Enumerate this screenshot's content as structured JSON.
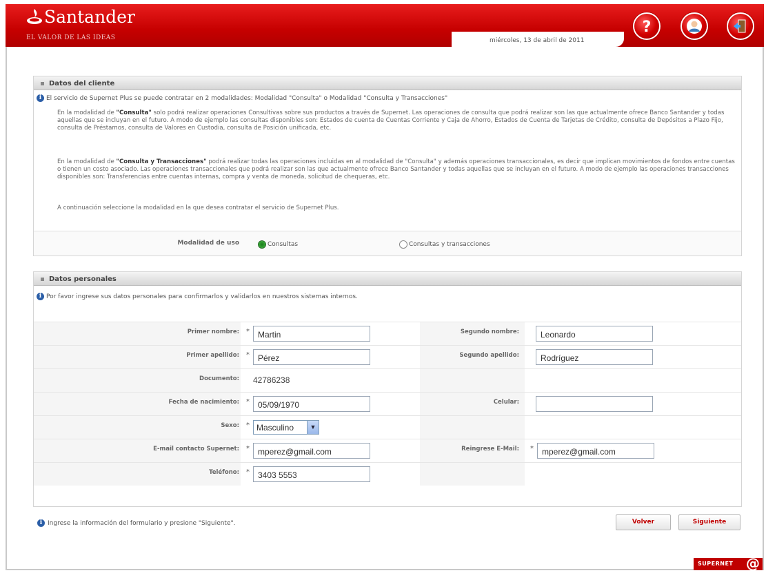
{
  "header": {
    "brand": "Santander",
    "tagline": "El Valor de las Ideas",
    "date": "miércoles, 13 de abril de 2011",
    "icons": [
      "help-icon",
      "user-icon",
      "exit-icon"
    ]
  },
  "cliente": {
    "title": "Datos del cliente",
    "intro": "El servicio de Supernet Plus se puede contratar en 2 modalidades: Modalidad \"Consulta\" o Modalidad \"Consulta y Transacciones\"",
    "para1_a": "En la modalidad de ",
    "para1_b": "\"Consulta\"",
    "para1_c": " solo podrá realizar operaciones Consultivas sobre sus productos a través de Supernet. Las operaciones de consulta que podrá realizar son las que actualmente ofrece Banco Santander y todas aquellas que se incluyan en el futuro. A modo de ejemplo las consultas disponibles son: Estados de cuenta de Cuentas Corriente y Caja de Ahorro, Estados de Cuenta de Tarjetas de Crédito, consulta de Depósitos a Plazo Fijo, consulta de Préstamos, consulta de Valores en Custodia, consulta de Posición unificada, etc.",
    "para2_a": "En la modalidad de ",
    "para2_b": "\"Consulta y Transacciones\"",
    "para2_c": " podrá realizar todas las operaciones incluidas en al modalidad de \"Consulta\" y además operaciones transaccionales, es decir que implican movimientos de fondos entre cuentas o tienen un costo asociado. Las operaciones transaccionales que podrá realizar son las que actualmente ofrece Banco Santander y todas aquellas que se incluyan en el futuro. A modo de ejemplo las operaciones transacciones disponibles son: Transferencias entre cuentas internas, compra y venta de moneda, solicitud de chequeras, etc.",
    "para3": "A continuación seleccione la modalidad en la que desea contratar el servicio de Supernet Plus.",
    "modalidad_label": "Modalidad de uso",
    "option_consultas": "Consultas",
    "option_trans": "Consultas y transacciones",
    "selected": "Consultas"
  },
  "personales": {
    "title": "Datos personales",
    "intro": "Por favor ingrese sus datos personales para confirmarlos y validarlos en nuestros sistemas internos.",
    "primer_nombre_label": "Primer nombre:",
    "primer_nombre": "Martin",
    "segundo_nombre_label": "Segundo nombre:",
    "segundo_nombre": "Leonardo",
    "primer_apellido_label": "Primer apellido:",
    "primer_apellido": "Pérez",
    "segundo_apellido_label": "Segundo apellido:",
    "segundo_apellido": "Rodríguez",
    "documento_label": "Documento:",
    "documento": "42786238",
    "fecha_label": "Fecha de nacimiento:",
    "fecha": "05/09/1970",
    "celular_label": "Celular:",
    "celular": "",
    "sexo_label": "Sexo:",
    "sexo": "Masculino",
    "email_label": "E-mail contacto Supernet:",
    "email": "mperez@gmail.com",
    "reemail_label": "Reingrese E-Mail:",
    "reemail": "mperez@gmail.com",
    "telefono_label": "Teléfono:",
    "telefono": "3403 5553",
    "required_mark": "*"
  },
  "footer": {
    "hint": "Ingrese la información del formulario y presione \"Siguiente\".",
    "volver": "Volver",
    "siguiente": "Siguiente",
    "supernet": "Supernet",
    "supernet_at": "@"
  }
}
